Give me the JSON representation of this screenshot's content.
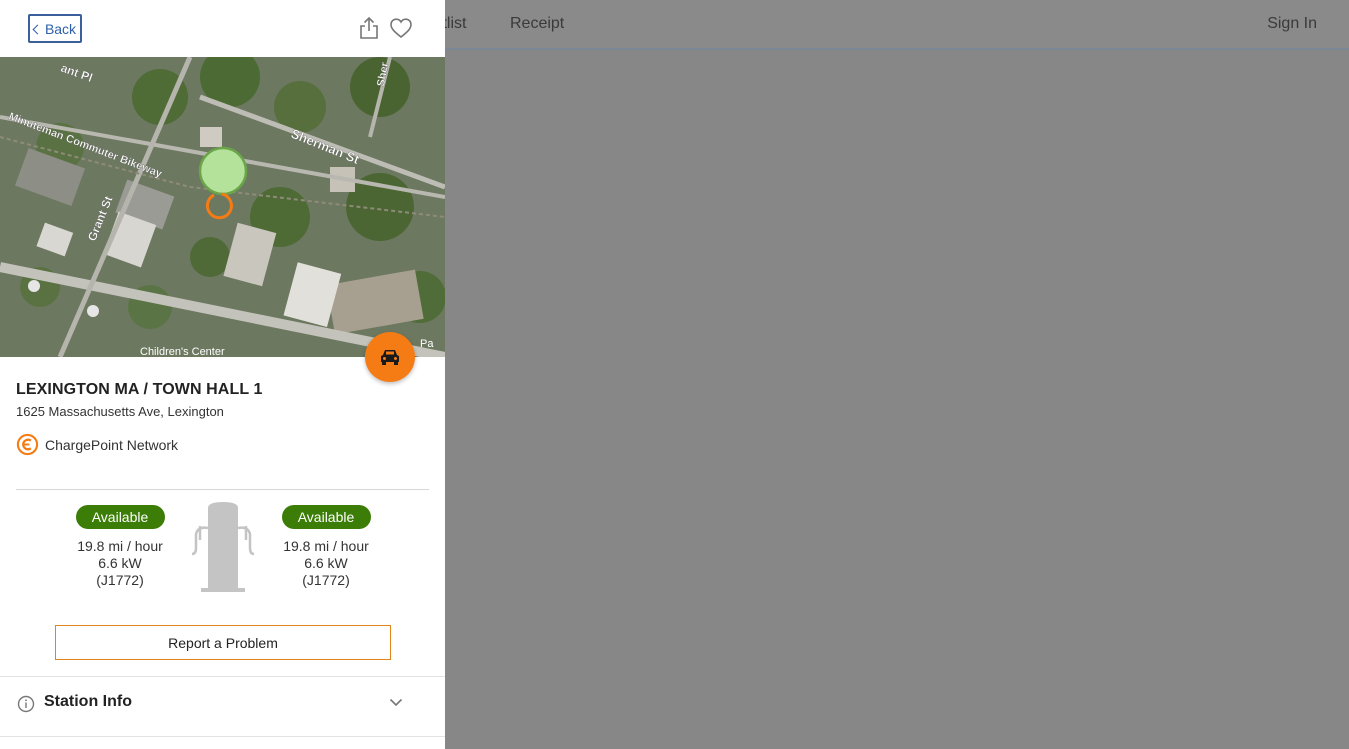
{
  "background_nav": {
    "waitlist": "aitlist",
    "receipt": "Receipt",
    "sign_in": "Sign In"
  },
  "header": {
    "back_label": "Back"
  },
  "map": {
    "labels": {
      "street_grant_pl": "ant Pl",
      "bikeway": "Minuteman Commuter Bikeway",
      "sherman_st": "Sherman St",
      "sherman_st_vertical": "Sher",
      "grant_st": "Grant St",
      "childrens_center": "Children's Center",
      "park": "Pa"
    }
  },
  "station": {
    "name": "LEXINGTON MA / TOWN HALL 1",
    "address": "1625 Massachusetts Ave, Lexington",
    "network": "ChargePoint Network"
  },
  "ports": [
    {
      "status": "Available",
      "rate": "19.8 mi / hour",
      "power": "6.6 kW",
      "connector": "(J1772)"
    },
    {
      "status": "Available",
      "rate": "19.8 mi / hour",
      "power": "6.6 kW",
      "connector": "(J1772)"
    }
  ],
  "actions": {
    "report_label": "Report a Problem"
  },
  "sections": {
    "station_info": "Station Info"
  },
  "colors": {
    "accent_orange": "#f57c14",
    "available_green": "#3b7d07",
    "link_blue": "#2d5fa8"
  }
}
